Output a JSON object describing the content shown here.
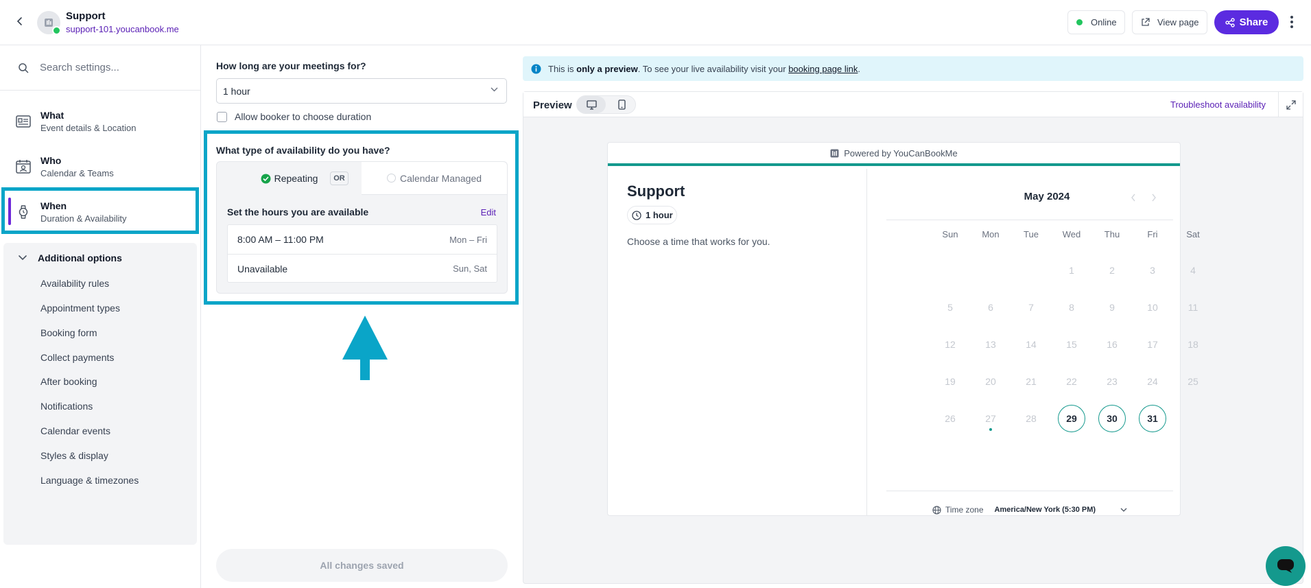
{
  "header": {
    "title": "Support",
    "url": "support-101.youcanbook.me",
    "online_label": "Online",
    "view_page_label": "View page",
    "share_label": "Share"
  },
  "sidebar": {
    "search_placeholder": "Search settings...",
    "items": [
      {
        "title": "What",
        "subtitle": "Event details & Location"
      },
      {
        "title": "Who",
        "subtitle": "Calendar & Teams"
      },
      {
        "title": "When",
        "subtitle": "Duration & Availability"
      }
    ],
    "additional": {
      "title": "Additional options",
      "items": [
        "Availability rules",
        "Appointment types",
        "Booking form",
        "Collect payments",
        "After booking",
        "Notifications",
        "Calendar events",
        "Styles & display",
        "Language & timezones"
      ]
    }
  },
  "middle": {
    "duration_question": "How long are your meetings for?",
    "duration_value": "1 hour",
    "allow_booker_label": "Allow booker to choose duration",
    "availability_question": "What type of availability do you have?",
    "option_repeating": "Repeating",
    "or_label": "OR",
    "option_calendar": "Calendar Managed",
    "hours_title": "Set the hours you are available",
    "edit_label": "Edit",
    "hours": [
      {
        "time": "8:00 AM – 11:00 PM",
        "days": "Mon – Fri"
      },
      {
        "time": "Unavailable",
        "days": "Sun, Sat"
      }
    ],
    "saved_label": "All changes saved"
  },
  "info": {
    "prefix": "This is ",
    "bold": "only a preview",
    "middle": ". To see your live availability visit your ",
    "link": "booking page link",
    "suffix": "."
  },
  "preview": {
    "label": "Preview",
    "troubleshoot": "Troubleshoot availability",
    "powered_by": "Powered by YouCanBookMe",
    "title": "Support",
    "duration": "1 hour",
    "description": "Choose a time that works for you.",
    "month": "May 2024",
    "weekdays": [
      "Sun",
      "Mon",
      "Tue",
      "Wed",
      "Thu",
      "Fri",
      "Sat"
    ],
    "weeks": [
      [
        "",
        "",
        "",
        "1",
        "2",
        "3",
        "4"
      ],
      [
        "5",
        "6",
        "7",
        "8",
        "9",
        "10",
        "11"
      ],
      [
        "12",
        "13",
        "14",
        "15",
        "16",
        "17",
        "18"
      ],
      [
        "19",
        "20",
        "21",
        "22",
        "23",
        "24",
        "25"
      ],
      [
        "26",
        "27",
        "28",
        "29",
        "30",
        "31",
        ""
      ]
    ],
    "available_days": [
      "29",
      "30",
      "31"
    ],
    "today": "27",
    "timezone_label": "Time zone",
    "timezone_value": "America/New York (5:30 PM)"
  },
  "colors": {
    "accent": "#5b2be0",
    "highlight_frame": "#0aa5c8",
    "brand_teal": "#14998d",
    "online": "#22c55e"
  }
}
